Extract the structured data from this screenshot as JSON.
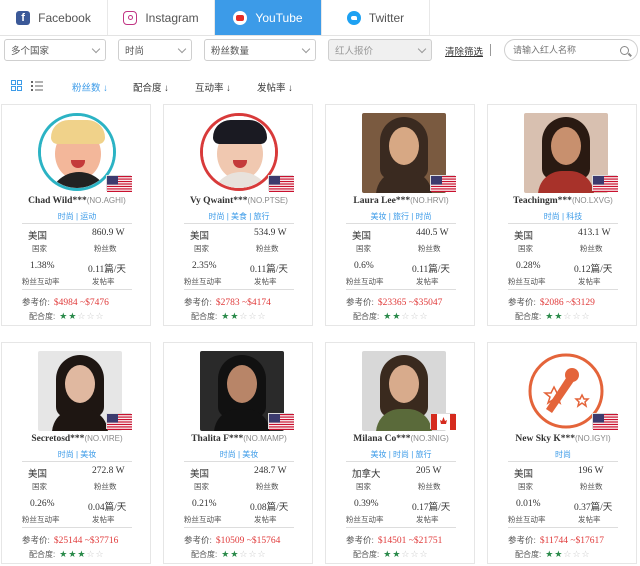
{
  "tabs": [
    {
      "label": "Facebook",
      "icon": "facebook-icon",
      "color": "#3b5998",
      "active": false
    },
    {
      "label": "Instagram",
      "icon": "instagram-icon",
      "color": "#c13584",
      "active": false
    },
    {
      "label": "YouTube",
      "icon": "youtube-icon",
      "color": "#e52d27",
      "active": true
    },
    {
      "label": "Twitter",
      "icon": "twitter-icon",
      "color": "#1da1f2",
      "active": false
    }
  ],
  "filters": {
    "country": "多个国家",
    "category": "时尚",
    "followers": "粉丝数量",
    "price": "红人报价",
    "reset": "清除筛选",
    "search_placeholder": "请输入红人名称"
  },
  "sort": {
    "items": [
      {
        "label": "粉丝数 ↓",
        "active": true
      },
      {
        "label": "配合度 ↓",
        "active": false
      },
      {
        "label": "互动率 ↓",
        "active": false
      },
      {
        "label": "发帖率 ↓",
        "active": false
      }
    ]
  },
  "labels": {
    "country": "国家",
    "followers": "粉丝数",
    "engagement": "粉丝互动率",
    "post_rate": "发帖率",
    "price": "参考价:",
    "match": "配合度:"
  },
  "accent": "#3c9be8",
  "price_color": "#e03a3a",
  "cards": [
    {
      "name": "Chad Wild***",
      "no": "(NO.AGHI)",
      "cats": "时尚 | 运动",
      "country": "美国",
      "followers": "860.9 W",
      "engagement": "1.38%",
      "post_rate": "0.11篇/天",
      "price": "$4984 ~$7476",
      "stars": 2,
      "flag": "us",
      "photo": "avatar-ring-teal"
    },
    {
      "name": "Vy Qwaint***",
      "no": "(NO.PTSE)",
      "cats": "时尚 | 美食 | 旅行",
      "country": "美国",
      "followers": "534.9 W",
      "engagement": "2.35%",
      "post_rate": "0.11篇/天",
      "price": "$2783 ~$4174",
      "stars": 2,
      "flag": "us",
      "photo": "avatar-ring-red"
    },
    {
      "name": "Laura Lee***",
      "no": "(NO.HRVI)",
      "cats": "美妆 | 旅行 | 时尚",
      "country": "美国",
      "followers": "440.5 W",
      "engagement": "0.6%",
      "post_rate": "0.11篇/天",
      "price": "$23365 ~$35047",
      "stars": 2,
      "flag": "us",
      "photo": "square"
    },
    {
      "name": "Teachingm***",
      "no": "(NO.LXVG)",
      "cats": "时尚 | 科技",
      "country": "美国",
      "followers": "413.1 W",
      "engagement": "0.28%",
      "post_rate": "0.12篇/天",
      "price": "$2086 ~$3129",
      "stars": 2,
      "flag": "us",
      "photo": "square"
    },
    {
      "name": "Secretosd***",
      "no": "(NO.VIRE)",
      "cats": "时尚 | 美妆",
      "country": "美国",
      "followers": "272.8 W",
      "engagement": "0.26%",
      "post_rate": "0.04篇/天",
      "price": "$25144 ~$37716",
      "stars": 3,
      "flag": "us",
      "photo": "square"
    },
    {
      "name": "Thalita F***",
      "no": "(NO.MAMP)",
      "cats": "时尚 | 美妆",
      "country": "美国",
      "followers": "248.7 W",
      "engagement": "0.21%",
      "post_rate": "0.08篇/天",
      "price": "$10509 ~$15764",
      "stars": 2,
      "flag": "us",
      "photo": "square"
    },
    {
      "name": "Milana Co***",
      "no": "(NO.3NIG)",
      "cats": "美妆 | 时尚 | 旅行",
      "country": "加拿大",
      "followers": "205 W",
      "engagement": "0.39%",
      "post_rate": "0.17篇/天",
      "price": "$14501 ~$21751",
      "stars": 2,
      "flag": "ca",
      "photo": "square"
    },
    {
      "name": "New Sky K***",
      "no": "(NO.IGYI)",
      "cats": "时尚",
      "country": "美国",
      "followers": "196 W",
      "engagement": "0.01%",
      "post_rate": "0.37篇/天",
      "price": "$11744 ~$17617",
      "stars": 2,
      "flag": "us",
      "photo": "logo"
    }
  ]
}
